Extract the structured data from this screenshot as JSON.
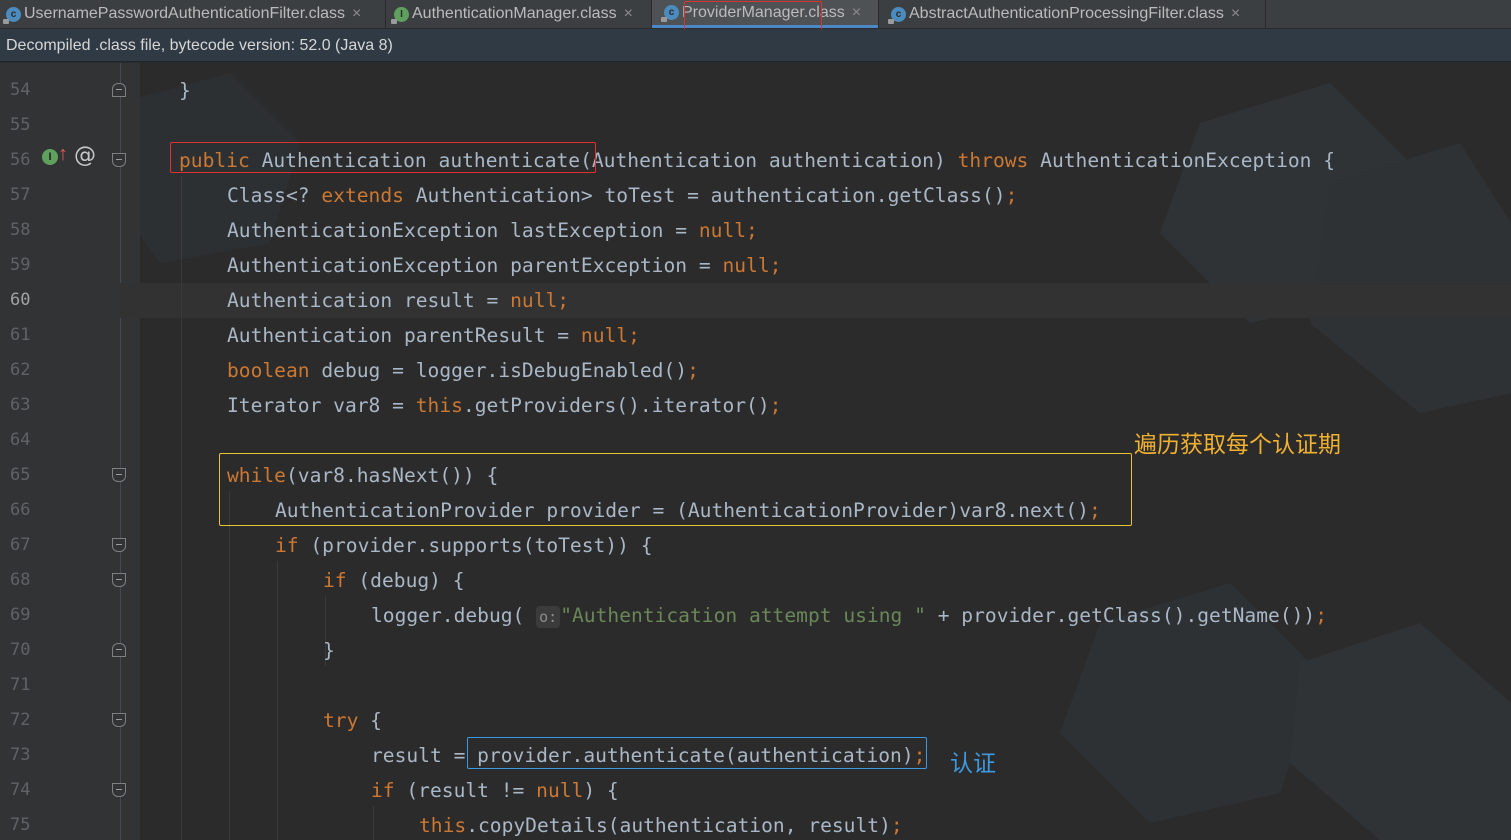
{
  "tabs": [
    {
      "label": "UsernamePasswordAuthenticationFilter.class",
      "icon": "class-file-icon",
      "active": false
    },
    {
      "label": "AuthenticationManager.class",
      "icon": "interface-file-icon",
      "active": false
    },
    {
      "label": "ProviderManager.class",
      "icon": "class-file-icon",
      "active": true
    },
    {
      "label": "AbstractAuthenticationProcessingFilter.class",
      "icon": "class-file-icon",
      "active": false
    }
  ],
  "close_glyph": "×",
  "banner": "Decompiled .class file, bytecode version: 52.0 (Java 8)",
  "lines": [
    {
      "n": "54"
    },
    {
      "n": "55"
    },
    {
      "n": "56"
    },
    {
      "n": "57"
    },
    {
      "n": "58"
    },
    {
      "n": "59"
    },
    {
      "n": "60"
    },
    {
      "n": "61"
    },
    {
      "n": "62"
    },
    {
      "n": "63"
    },
    {
      "n": "64"
    },
    {
      "n": "65"
    },
    {
      "n": "66"
    },
    {
      "n": "67"
    },
    {
      "n": "68"
    },
    {
      "n": "69"
    },
    {
      "n": "70"
    },
    {
      "n": "71"
    },
    {
      "n": "72"
    },
    {
      "n": "73"
    },
    {
      "n": "74"
    },
    {
      "n": "75"
    }
  ],
  "current_line": "60",
  "gutter_icons": {
    "implements": "I",
    "arrow": "↑",
    "at": "@"
  },
  "param_hint": "o:",
  "annotations": {
    "loop_note": "遍历获取每个认证期",
    "auth_note": "认证"
  },
  "colors": {
    "keyword": "#cc7832",
    "string": "#6a8759",
    "text": "#a9b7c6",
    "red_box": "#e03030",
    "yellow_box": "#e8c33a",
    "blue_box": "#3d9ae0",
    "note_orange": "#f0b030",
    "note_blue": "#3d9ae0"
  }
}
